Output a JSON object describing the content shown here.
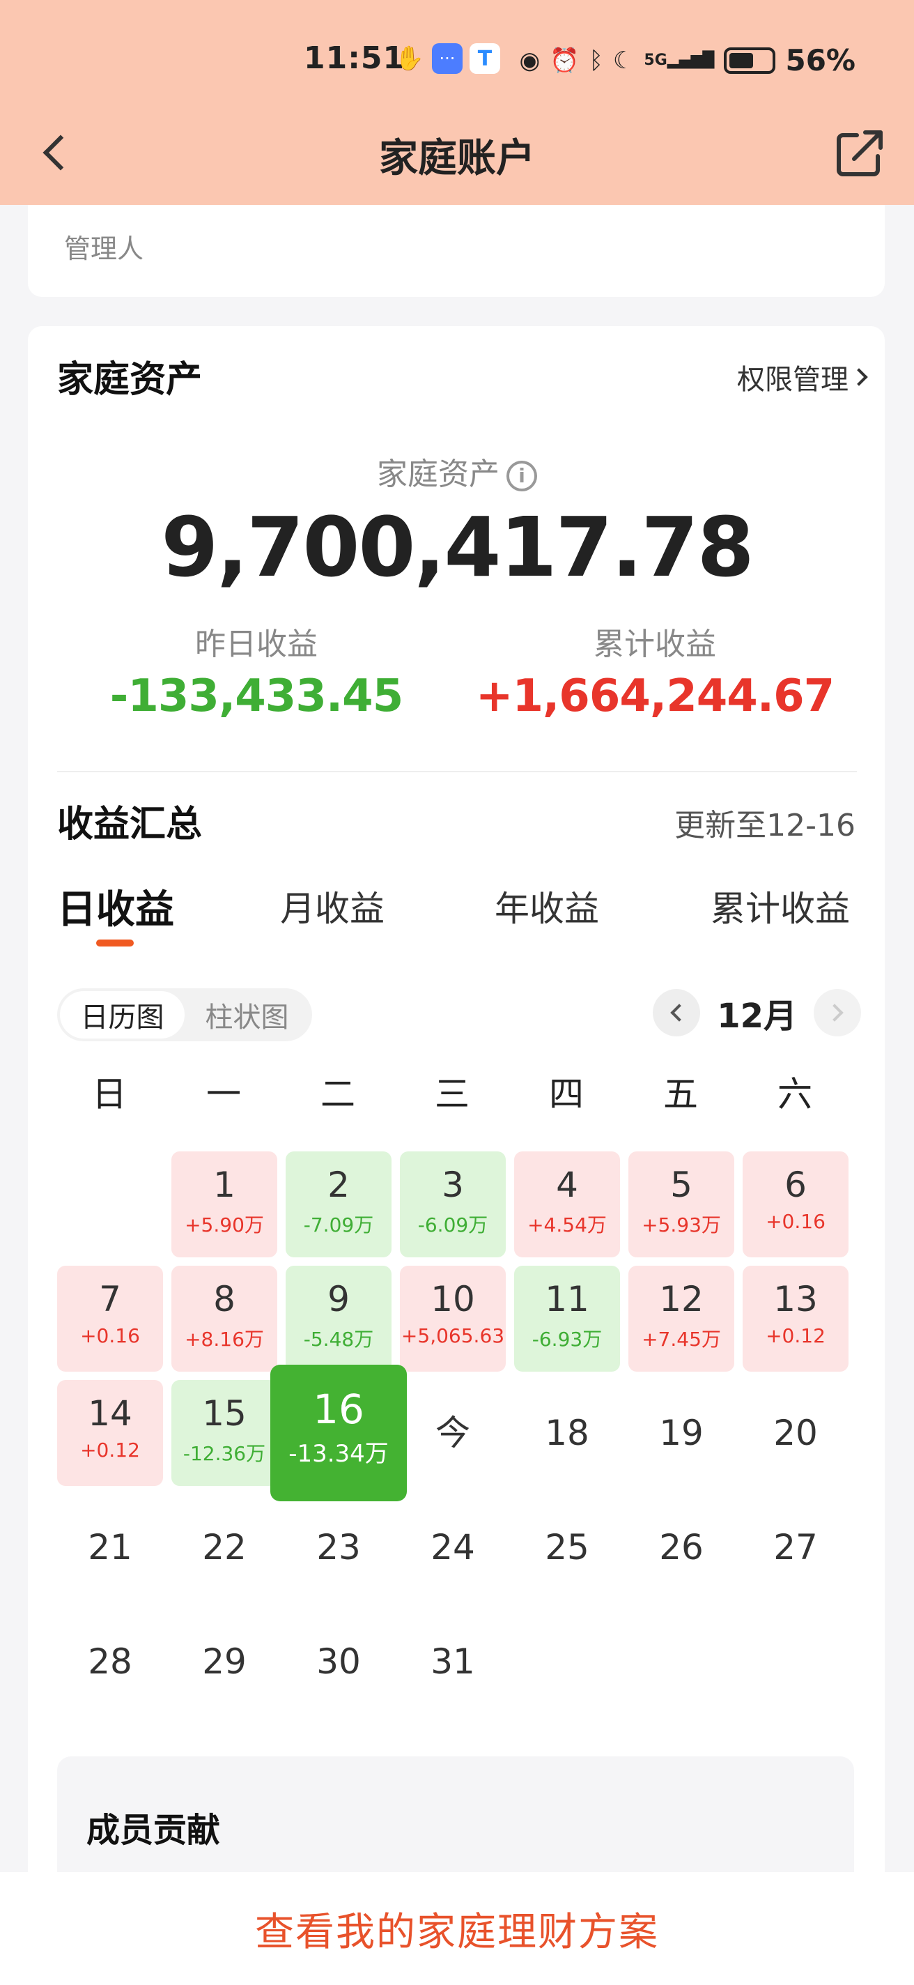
{
  "status_bar": {
    "time": "11:51",
    "signal": "5G",
    "battery": "56%"
  },
  "nav": {
    "title": "家庭账户"
  },
  "top_card": {
    "manager_label": "管理人"
  },
  "assets": {
    "section_title": "家庭资产",
    "permission_link": "权限管理",
    "asset_label": "家庭资产",
    "asset_value": "9,700,417.78",
    "yesterday_label": "昨日收益",
    "yesterday_value": "-133,433.45",
    "total_label": "累计收益",
    "total_value": "+1,664,244.67"
  },
  "summary": {
    "title": "收益汇总",
    "updated": "更新至12-16",
    "tabs": [
      "日收益",
      "月收益",
      "年收益",
      "累计收益"
    ],
    "toggle": [
      "日历图",
      "柱状图"
    ],
    "month": "12月",
    "weekdays": [
      "日",
      "一",
      "二",
      "三",
      "四",
      "五",
      "六"
    ]
  },
  "calendar": [
    {
      "day": "1",
      "val": "+5.90万",
      "type": "pos"
    },
    {
      "day": "2",
      "val": "-7.09万",
      "type": "neg"
    },
    {
      "day": "3",
      "val": "-6.09万",
      "type": "neg"
    },
    {
      "day": "4",
      "val": "+4.54万",
      "type": "pos"
    },
    {
      "day": "5",
      "val": "+5.93万",
      "type": "pos"
    },
    {
      "day": "6",
      "val": "+0.16",
      "type": "pos"
    },
    {
      "day": "7",
      "val": "+0.16",
      "type": "pos"
    },
    {
      "day": "8",
      "val": "+8.16万",
      "type": "pos"
    },
    {
      "day": "9",
      "val": "-5.48万",
      "type": "neg"
    },
    {
      "day": "10",
      "val": "+5,065.63",
      "type": "pos"
    },
    {
      "day": "11",
      "val": "-6.93万",
      "type": "neg"
    },
    {
      "day": "12",
      "val": "+7.45万",
      "type": "pos"
    },
    {
      "day": "13",
      "val": "+0.12",
      "type": "pos"
    },
    {
      "day": "14",
      "val": "+0.12",
      "type": "pos"
    },
    {
      "day": "15",
      "val": "-12.36万",
      "type": "neg"
    },
    {
      "day": "16",
      "val": "-13.34万",
      "type": "selected"
    },
    {
      "day": "今",
      "val": "",
      "type": "plain"
    },
    {
      "day": "18",
      "val": "",
      "type": "plain"
    },
    {
      "day": "19",
      "val": "",
      "type": "plain"
    },
    {
      "day": "20",
      "val": "",
      "type": "plain"
    },
    {
      "day": "21",
      "val": "",
      "type": "plain"
    },
    {
      "day": "22",
      "val": "",
      "type": "plain"
    },
    {
      "day": "23",
      "val": "",
      "type": "plain"
    },
    {
      "day": "24",
      "val": "",
      "type": "plain"
    },
    {
      "day": "25",
      "val": "",
      "type": "plain"
    },
    {
      "day": "26",
      "val": "",
      "type": "plain"
    },
    {
      "day": "27",
      "val": "",
      "type": "plain"
    },
    {
      "day": "28",
      "val": "",
      "type": "plain"
    },
    {
      "day": "29",
      "val": "",
      "type": "plain"
    },
    {
      "day": "30",
      "val": "",
      "type": "plain"
    },
    {
      "day": "31",
      "val": "",
      "type": "plain"
    }
  ],
  "members": {
    "title": "成员贡献"
  },
  "bottom": {
    "button": "查看我的家庭理财方案"
  }
}
